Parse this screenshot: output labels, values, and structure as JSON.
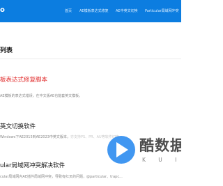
{
  "header": {
    "logo_text": "o",
    "nav": [
      "首页",
      "AE模板表达式修复",
      "AE中英文切换",
      "Particular局域网冲突"
    ]
  },
  "section": {
    "title": "列表"
  },
  "articles": [
    {
      "title": "板表达式修复脚本",
      "desc": "AE模板的表达式错误，在中文版AE也能套英文模板。",
      "desc_faint": ""
    },
    {
      "title": "英文切换软件",
      "desc": "Windows下AE2015到AE2023中英文版本，",
      "desc_faint": "亦支持PS、PR、AU等软件切换"
    },
    {
      "title": "ular局域网冲突解决软件",
      "desc": "cular局域网内AE插件局域网冲突，导致有红叉的问题，@particular、trapc...",
      "desc_faint": ""
    }
  ],
  "watermark": {
    "brand": "酷数据",
    "sub": "K U I D C"
  },
  "colors": {
    "header_bg": "#0c7de0",
    "accent_red": "#e02a2a",
    "watermark_blue": "#2d8cf0"
  }
}
